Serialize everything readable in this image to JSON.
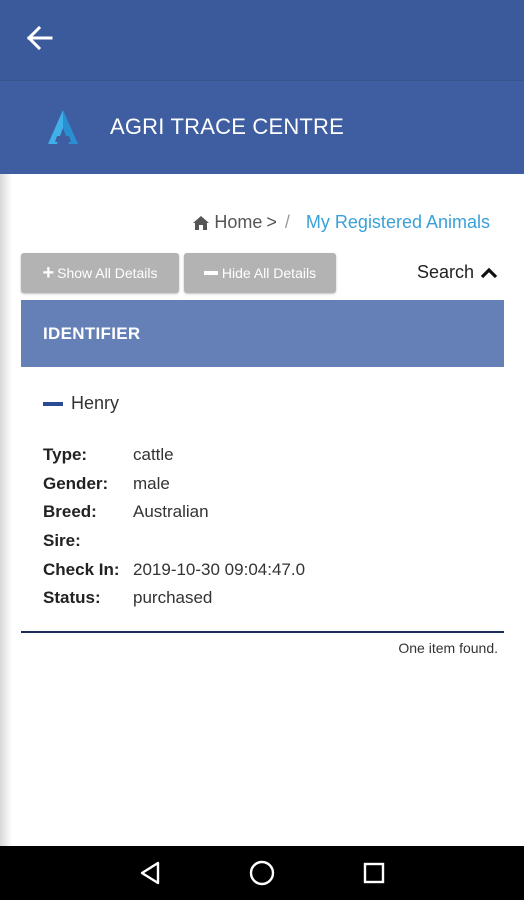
{
  "app": {
    "title": "AGRI TRACE CENTRE",
    "colors": {
      "topbar": "#3a5a9c",
      "brandbar": "#3e5ea1",
      "section_header": "#6480b6",
      "link": "#3aa0d8",
      "button": "#b3b3b3"
    }
  },
  "breadcrumb": {
    "home": "Home",
    "separator": ">",
    "divider": "/",
    "current": "My Registered Animals"
  },
  "toolbar": {
    "show_all": "Show All Details",
    "hide_all": "Hide All Details",
    "search": "Search"
  },
  "list": {
    "header": "IDENTIFIER",
    "items": [
      {
        "name": "Henry",
        "fields": [
          {
            "label": "Type:",
            "value": "cattle"
          },
          {
            "label": "Gender:",
            "value": "male"
          },
          {
            "label": "Breed:",
            "value": "Australian"
          },
          {
            "label": "Sire:",
            "value": ""
          },
          {
            "label": "Check In:",
            "value": "2019-10-30 09:04:47.0"
          },
          {
            "label": "Status:",
            "value": "purchased"
          }
        ]
      }
    ],
    "summary": "One item found."
  },
  "icons": {
    "back": "arrow-left-icon",
    "home": "home-icon",
    "search_toggle": "chevron-up-icon",
    "logo": "agri-logo-icon",
    "nav": [
      "back-triangle-icon",
      "home-circle-icon",
      "recents-square-icon"
    ]
  }
}
